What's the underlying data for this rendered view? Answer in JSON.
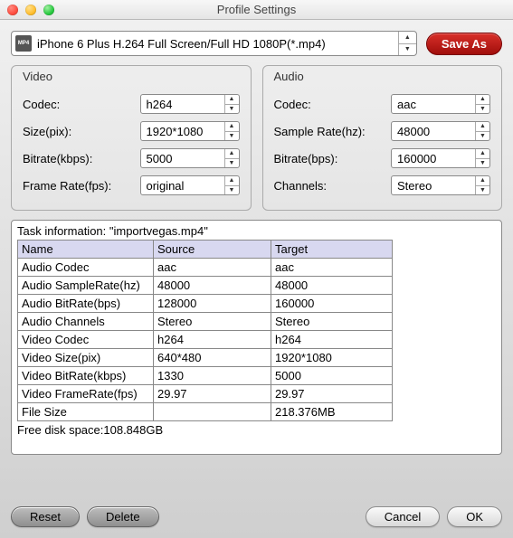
{
  "window": {
    "title": "Profile Settings"
  },
  "profile": {
    "selected": "iPhone 6 Plus H.264 Full Screen/Full HD 1080P(*.mp4)",
    "save_as_label": "Save As"
  },
  "video": {
    "section_title": "Video",
    "codec_label": "Codec:",
    "codec_value": "h264",
    "size_label": "Size(pix):",
    "size_value": "1920*1080",
    "bitrate_label": "Bitrate(kbps):",
    "bitrate_value": "5000",
    "framerate_label": "Frame Rate(fps):",
    "framerate_value": "original"
  },
  "audio": {
    "section_title": "Audio",
    "codec_label": "Codec:",
    "codec_value": "aac",
    "samplerate_label": "Sample Rate(hz):",
    "samplerate_value": "48000",
    "bitrate_label": "Bitrate(bps):",
    "bitrate_value": "160000",
    "channels_label": "Channels:",
    "channels_value": "Stereo"
  },
  "task": {
    "header": "Task information: \"importvegas.mp4\"",
    "columns": {
      "name": "Name",
      "source": "Source",
      "target": "Target"
    },
    "rows": [
      {
        "name": "Audio Codec",
        "source": "aac",
        "target": "aac"
      },
      {
        "name": "Audio SampleRate(hz)",
        "source": "48000",
        "target": "48000"
      },
      {
        "name": "Audio BitRate(bps)",
        "source": "128000",
        "target": "160000"
      },
      {
        "name": "Audio Channels",
        "source": "Stereo",
        "target": "Stereo"
      },
      {
        "name": "Video Codec",
        "source": "h264",
        "target": "h264"
      },
      {
        "name": "Video Size(pix)",
        "source": "640*480",
        "target": "1920*1080"
      },
      {
        "name": "Video BitRate(kbps)",
        "source": "1330",
        "target": "5000"
      },
      {
        "name": "Video FrameRate(fps)",
        "source": "29.97",
        "target": "29.97"
      },
      {
        "name": "File Size",
        "source": "",
        "target": "218.376MB"
      }
    ],
    "freedisk": "Free disk space:108.848GB"
  },
  "buttons": {
    "reset": "Reset",
    "delete": "Delete",
    "cancel": "Cancel",
    "ok": "OK"
  },
  "icons": {
    "mp4": "MP4"
  }
}
